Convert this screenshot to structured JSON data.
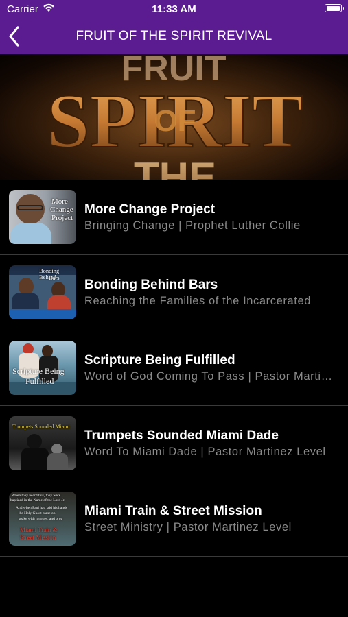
{
  "status_bar": {
    "carrier": "Carrier",
    "time": "11:33 AM"
  },
  "nav": {
    "title": "FRUIT OF THE SPIRIT REVIVAL"
  },
  "banner": {
    "words": [
      "FRUIT",
      "SPIRIT",
      "OF",
      "THE"
    ]
  },
  "items": [
    {
      "title": "More Change Project",
      "subtitle": "Bringing Change |  Prophet Luther Collie",
      "thumb_text": [
        "More",
        "Change",
        "Project"
      ]
    },
    {
      "title": "Bonding Behind Bars",
      "subtitle": "Reaching the Families of the Incarcerated",
      "thumb_text": [
        "Bonding Behind",
        "Bars"
      ]
    },
    {
      "title": "Scripture Being Fulfilled",
      "subtitle": "Word of God Coming To Pass |  Pastor Martinez Level",
      "thumb_text": [
        "Scripture Being",
        "Fulfilled"
      ]
    },
    {
      "title": "Trumpets Sounded Miami Dade",
      "subtitle": "Word To Miami Dade |  Pastor Martinez Level",
      "thumb_text": [
        "Trumpets Sounded Miami"
      ]
    },
    {
      "title": "Miami Train & Street Mission",
      "subtitle": "Street Ministry |  Pastor Martinez Level",
      "thumb_text": [
        "When they heard this, they were",
        "baptized in the Name of the Lord Je",
        "And when Paul had laid his hands",
        "the Holy Ghost came on",
        "spake with tongues, and prop",
        "Miami Train &",
        "Street Mission"
      ]
    }
  ]
}
